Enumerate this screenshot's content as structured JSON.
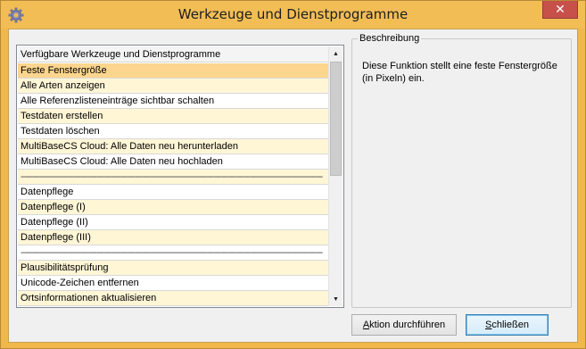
{
  "window": {
    "title": "Werkzeuge und Dienstprogramme",
    "close_label": "✕",
    "title_icon": "gear-icon"
  },
  "tools_list": {
    "header": "Verfügbare Werkzeuge und Dienstprogramme",
    "items": [
      "Feste Fenstergröße",
      "Alle Arten anzeigen",
      "Alle Referenzlisteneinträge sichtbar schalten",
      "Testdaten erstellen",
      "Testdaten löschen",
      "MultiBaseCS Cloud: Alle Daten neu herunterladen",
      "MultiBaseCS Cloud: Alle Daten neu hochladen",
      "-------------------------------------------------------------------------------------------------------------------------------",
      "Datenpflege",
      "Datenpflege (I)",
      "Datenpflege (II)",
      "Datenpflege (III)",
      "-------------------------------------------------------------------------------------------------------------------------------",
      "Plausibilitätsprüfung",
      "Unicode-Zeichen entfernen",
      "Ortsinformationen aktualisieren"
    ],
    "selected_index": 0
  },
  "description": {
    "legend": "Beschreibung",
    "text": "Diese Funktion stellt eine feste Fenstergröße (in Pixeln) ein."
  },
  "buttons": {
    "action_mnemonic": "A",
    "action_rest": "ktion durchführen",
    "close_mnemonic": "S",
    "close_rest": "chließen"
  }
}
